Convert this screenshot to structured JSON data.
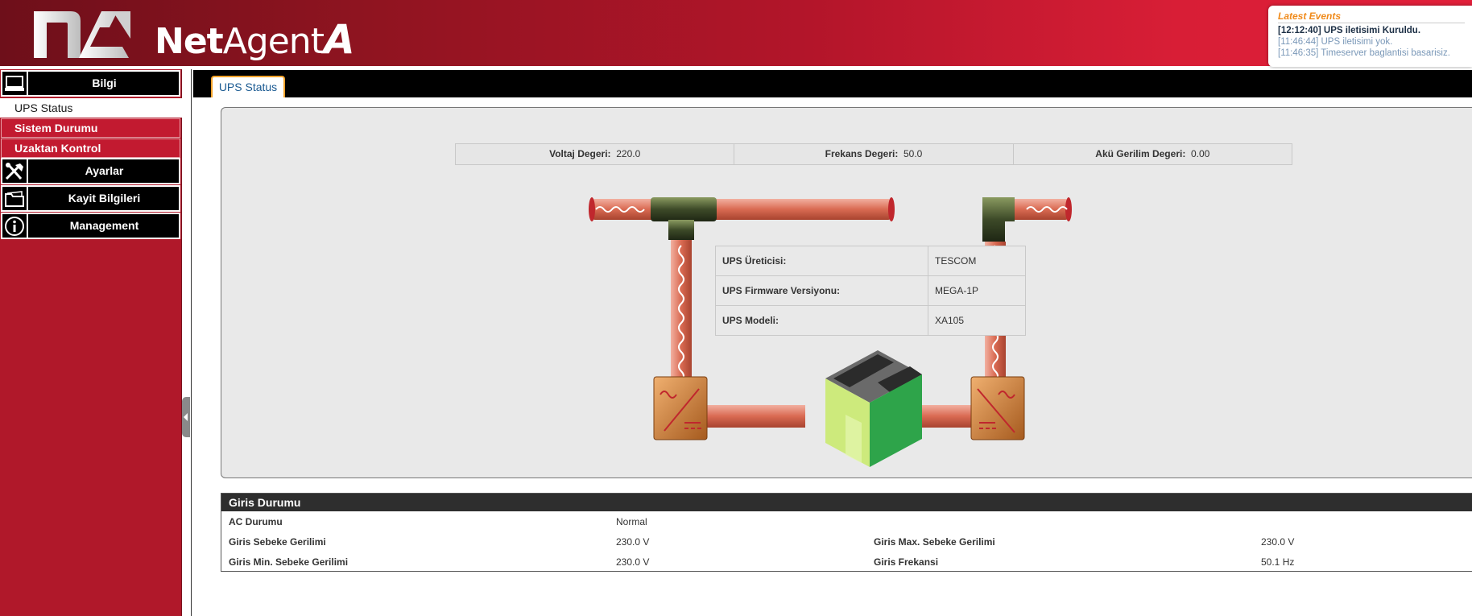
{
  "header": {
    "brand_net": "Net",
    "brand_agent": "Agent",
    "brand_a": "A"
  },
  "events": {
    "title": "Latest Events",
    "items": [
      "[12:12:40] UPS iletisimi Kuruldu.",
      "[11:46:44] UPS iletisimi yok.",
      "[11:46:35] Timeserver baglantisi basarisiz."
    ]
  },
  "sidebar": {
    "bilgi": "Bilgi",
    "ups_status": "UPS Status",
    "sistem_durumu": "Sistem Durumu",
    "uzaktan_kontrol": "Uzaktan Kontrol",
    "ayarlar": "Ayarlar",
    "kayit": "Kayit Bilgileri",
    "management": "Management"
  },
  "tab": {
    "label": "UPS Status"
  },
  "metrics": [
    {
      "label": "Voltaj Degeri:",
      "value": "220.0"
    },
    {
      "label": "Frekans Degeri:",
      "value": "50.0"
    },
    {
      "label": "Akü Gerilim Degeri:",
      "value": "0.00"
    }
  ],
  "ups_info": [
    {
      "key": "UPS Üreticisi:",
      "value": "TESCOM"
    },
    {
      "key": "UPS Firmware Versiyonu:",
      "value": "MEGA-1P"
    },
    {
      "key": "UPS Modeli:",
      "value": "XA105"
    }
  ],
  "giris": {
    "title": "Giris Durumu",
    "ac_label": "AC Durumu",
    "ac_value": "Normal",
    "sebeke_label": "Giris Sebeke Gerilimi",
    "sebeke_value": "230.0 V",
    "max_label": "Giris Max. Sebeke Gerilimi",
    "max_value": "230.0 V",
    "min_label": "Giris Min. Sebeke Gerilimi",
    "min_value": "230.0 V",
    "freq_label": "Giris Frekansi",
    "freq_value": "50.1 Hz"
  },
  "colors": {
    "brand_red": "#b0182a",
    "events_title": "#f08a1a",
    "tab_border": "#f2a22a",
    "tab_text": "#1a5a92"
  }
}
